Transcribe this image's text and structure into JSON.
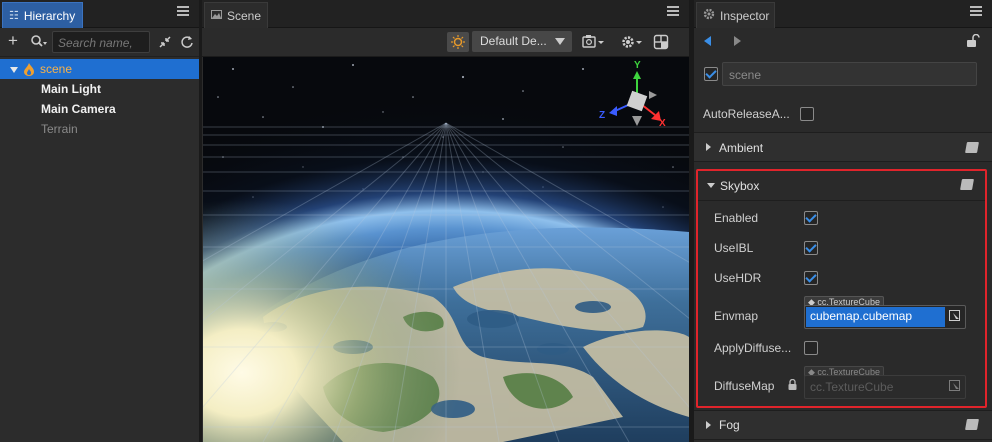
{
  "hierarchy": {
    "tab_label": "Hierarchy",
    "search_placeholder": "Search name,",
    "tree": [
      {
        "label": "scene",
        "level": 0,
        "selected": true
      },
      {
        "label": "Main Light",
        "level": 1
      },
      {
        "label": "Main Camera",
        "level": 1
      },
      {
        "label": "Terrain",
        "level": 1,
        "dim": true
      }
    ]
  },
  "scene": {
    "tab_label": "Scene",
    "dropdown_value": "Default De...",
    "gizmo": {
      "y": "Y",
      "z": "Z",
      "x": "X"
    }
  },
  "inspector": {
    "tab_label": "Inspector",
    "node_name": "scene",
    "auto_release_label": "AutoReleaseA...",
    "ambient_label": "Ambient",
    "skybox_label": "Skybox",
    "fog_label": "Fog",
    "skybox": {
      "enabled_label": "Enabled",
      "use_ibl_label": "UseIBL",
      "use_hdr_label": "UseHDR",
      "envmap_label": "Envmap",
      "envmap_type": "cc.TextureCube",
      "envmap_value": "cubemap.cubemap",
      "apply_diffuse_label": "ApplyDiffuse...",
      "diffuse_map_label": "DiffuseMap",
      "diffuse_map_type": "cc.TextureCube",
      "diffuse_map_placeholder": "cc.TextureCube"
    }
  },
  "colors": {
    "accent": "#2d5fa3",
    "highlight_border": "#e0242b",
    "selection": "#1f6fd1"
  }
}
